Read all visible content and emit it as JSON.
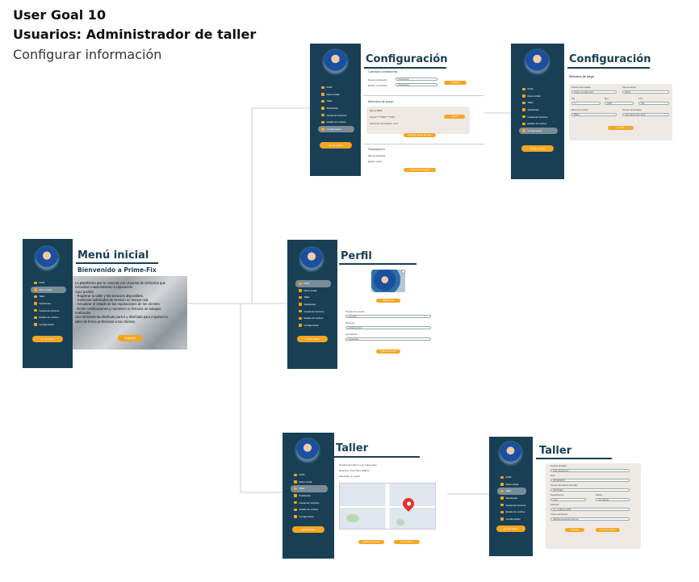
{
  "header": {
    "line1": "User Goal 10",
    "line2": "Usuarios: Administrador de taller",
    "line3": "Configurar información"
  },
  "nav_labels": [
    "Perfil",
    "Menú inicial",
    "Taller",
    "Solicitudes",
    "Gestionar técnicos",
    "Estado de coches",
    "Configuración"
  ],
  "logout_label": "Cerrar sesión",
  "menu": {
    "title": "Menú inicial",
    "welcome": "Bienvenido a Prime-Fix",
    "body": [
      "La plataforma que te conecta con usuarios de vehículos que",
      "necesitan mantenimiento o reparación.",
      "Aquí podrás:",
      "   · Registrar tu taller y los servicios disponibles.",
      "   · Gestionar solicitudes de servicio en tiempo real.",
      "   · Actualizar el estado de las reparaciones de tus clientes.",
      "   · Emitir certificaciones y mantener un historial de trabajos",
      "     realizados.",
      "Una herramienta diseñada para ti y diseñada para impulsar tu",
      "taller de forma profesional a tus clientes."
    ],
    "button": "Empezar"
  },
  "config1": {
    "title": "Configuración",
    "section_password": "Cambiar contraseña",
    "current_password": "Nueva contraseña",
    "repeat_password": "Repetir contraseña",
    "password_placeholder": "Contraseña",
    "save_button": "Guardar",
    "section_payment": "Métodos de pago",
    "card_name": "Banco BBVA",
    "card_number": "Tarjeta ****2938 ****3451",
    "card_exp": "Fecha de vencimiento: xx/xx",
    "edit_button": "Editar",
    "add_method_button": "Agregar método de pago",
    "section_subscription": "Suscripción",
    "plan_line": "Plan de Estándar",
    "renewal_line": "Estado: Activo",
    "manage_button": "Gestionar suscripción"
  },
  "config2": {
    "title": "Configuración",
    "section": "Métodos de pago",
    "holder_label": "Nombre de la tarjeta",
    "holder_value": "Pedro Gonzalez Ruiz",
    "type_label": "Tipo de tarjeta",
    "type_value": "Débito",
    "day_label": "Día",
    "day_value": "17",
    "month_label": "Mes",
    "month_value": "2028",
    "cvv_label": "CVV",
    "cvv_value": "574",
    "bank_label": "Banco de emisión",
    "bank_value": "BBVA",
    "number_label": "Número de la tarjeta",
    "number_value": "4444 4444 4444 4444",
    "save_button": "Guardar"
  },
  "profile": {
    "title": "Perfil",
    "edit_photo": "Editar perfil",
    "user_label": "Nombre de usuario",
    "user_value": "Leon123",
    "email_label": "Dirección",
    "email_value": "Carlitos fer24.1",
    "password_label": "Contraseña",
    "password_value": "Contraseña",
    "save_button": "Guardar cambios"
  },
  "taller1": {
    "title": "Taller",
    "name_line": "Nombre del taller: Leon Automotive",
    "address_line": "Dirección: Can Sant 1998 R",
    "location_line": "Ubicación en mapa",
    "edit_button": "Editar información",
    "services_button": "Ver servicios"
  },
  "taller2": {
    "title": "Taller",
    "name_label": "Nombre del taller",
    "name_value": "Taller Benavente",
    "ruc_label": "RUC",
    "ruc_value": "2874829188",
    "phone_label": "Número de teléfono del taller",
    "phone_value": "987654321",
    "dept_label": "Departamento",
    "dept_value": "Lima",
    "district_label": "Distrito",
    "district_value": "San Miguel",
    "address_label": "Dirección",
    "address_value": "Av. La Marina 1234",
    "ref_label": "Correo electrónico",
    "ref_value": "tallerbenavente@gmail.com",
    "cancel_button": "Cancelar",
    "save_button": "Guardar cambios"
  },
  "colors": {
    "sidebar": "#193f55",
    "accent": "#f5a623",
    "active_nav": "#7a8c98",
    "card": "#efe9e3",
    "map_pin": "#e5312b"
  }
}
